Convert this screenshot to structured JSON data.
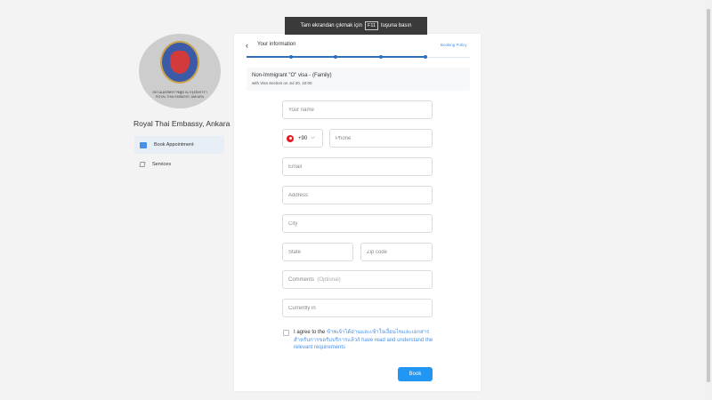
{
  "fullscreen_banner": {
    "before": "Tam ekrandan çıkmak için",
    "key": "F11",
    "after": "tuşuna basın"
  },
  "sidebar": {
    "logo_line1": "สถานเอกอัครราชทูต ณ กรุงอังการา",
    "logo_line2": "ROYAL THAI EMBASSY, ANKARA",
    "embassy_name": "Royal Thai Embassy, Ankara",
    "items": [
      {
        "label": "Book Appointment",
        "icon": "calendar-icon",
        "active": true
      },
      {
        "label": "Services",
        "icon": "edit-icon",
        "active": false
      }
    ]
  },
  "header": {
    "title": "Your information",
    "policy_link": "Booking Policy"
  },
  "progress": {
    "steps": 5,
    "completed": 4
  },
  "service": {
    "title": "Non-Immigrant \"O\" visa - (Family)",
    "subtitle": "with Visa Section on Jul 20, 10:00"
  },
  "form": {
    "name_placeholder": "Your name",
    "dial_code": "+90",
    "phone_placeholder": "Phone",
    "email_placeholder": "Email",
    "address_placeholder": "Address",
    "city_placeholder": "City",
    "state_placeholder": "State",
    "zip_placeholder": "Zip code",
    "comments_label": "Comments",
    "comments_optional": "(Optional)",
    "currently_in_placeholder": "Currently in"
  },
  "agreement": {
    "prefix": "I agree to the",
    "link_text": "ข้าพเจ้าได้อ่านและเข้าใจเงื่อนไขและเอกสารสำหรับการขอรับบริการแล้ว/I have read and understand the relevant requirements"
  },
  "book_button": "Book",
  "colors": {
    "accent": "#2196f3",
    "progress": "#2f6fb5",
    "link": "#4a90e2"
  }
}
